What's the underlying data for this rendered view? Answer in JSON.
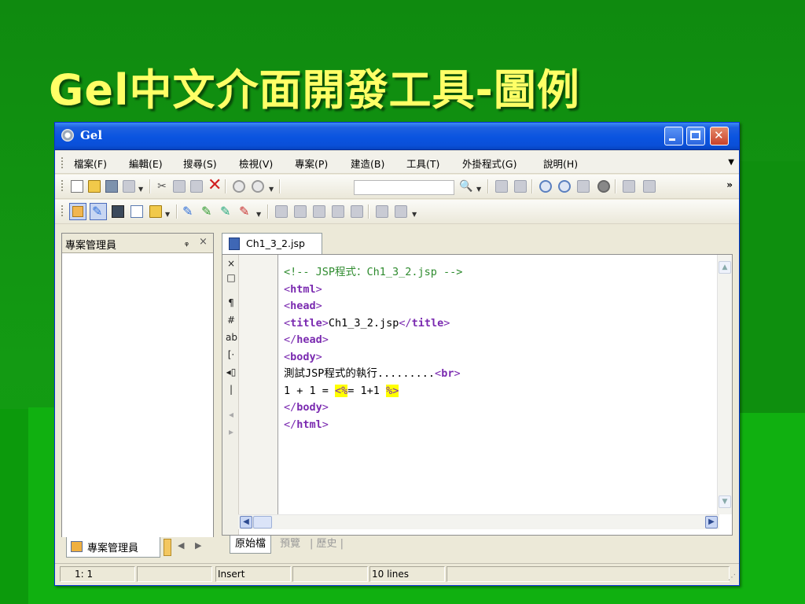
{
  "slide": {
    "title": "Gel中文介面開發工具-圖例"
  },
  "window": {
    "title": "Gel"
  },
  "menu": {
    "items": [
      "檔案(F)",
      "編輯(E)",
      "搜尋(S)",
      "檢視(V)",
      "專案(P)",
      "建造(B)",
      "工具(T)",
      "外掛程式(G)",
      "說明(H)"
    ]
  },
  "toolbar": {
    "combo_value": "",
    "overflow": "»"
  },
  "project_panel": {
    "title": "專案管理員",
    "pin": "ᵩ",
    "close": "×",
    "tab_label": "專案管理員"
  },
  "editor": {
    "tab_label": "Ch1_3_2.jsp",
    "lines": [
      [
        {
          "cls": "cm",
          "t": "<!-- JSP程式：Ch1_3_2.jsp -->"
        }
      ],
      [
        {
          "cls": "br",
          "t": "<"
        },
        {
          "cls": "tg",
          "t": "html"
        },
        {
          "cls": "br",
          "t": ">"
        }
      ],
      [
        {
          "cls": "br",
          "t": "<"
        },
        {
          "cls": "tg",
          "t": "head"
        },
        {
          "cls": "br",
          "t": ">"
        }
      ],
      [
        {
          "cls": "br",
          "t": "<"
        },
        {
          "cls": "tg",
          "t": "title"
        },
        {
          "cls": "br",
          "t": ">"
        },
        {
          "cls": "tx",
          "t": "Ch1_3_2.jsp"
        },
        {
          "cls": "br",
          "t": "</"
        },
        {
          "cls": "tg",
          "t": "title"
        },
        {
          "cls": "br",
          "t": ">"
        }
      ],
      [
        {
          "cls": "br",
          "t": "</"
        },
        {
          "cls": "tg",
          "t": "head"
        },
        {
          "cls": "br",
          "t": ">"
        }
      ],
      [
        {
          "cls": "br",
          "t": "<"
        },
        {
          "cls": "tg",
          "t": "body"
        },
        {
          "cls": "br",
          "t": ">"
        }
      ],
      [
        {
          "cls": "tx",
          "t": "測試JSP程式的執行........."
        },
        {
          "cls": "br",
          "t": "<"
        },
        {
          "cls": "tg",
          "t": "br"
        },
        {
          "cls": "br",
          "t": ">"
        }
      ],
      [
        {
          "cls": "tx",
          "t": "1 + 1 = "
        },
        {
          "cls": "hl",
          "t": "<%"
        },
        {
          "cls": "tx",
          "t": "= 1+1 "
        },
        {
          "cls": "hl",
          "t": "%>"
        }
      ],
      [
        {
          "cls": "br",
          "t": "</"
        },
        {
          "cls": "tg",
          "t": "body"
        },
        {
          "cls": "br",
          "t": ">"
        }
      ],
      [
        {
          "cls": "br",
          "t": "</"
        },
        {
          "cls": "tg",
          "t": "html"
        },
        {
          "cls": "br",
          "t": ">"
        }
      ]
    ],
    "view_tabs": [
      "原始檔",
      "預覽",
      "歷史"
    ]
  },
  "status": {
    "position": "1: 1",
    "mode": "Insert",
    "lines": "10 lines"
  },
  "colors": {
    "comment": "#2e8b2e",
    "tag": "#7a2ab0",
    "highlight": "#ffff00",
    "title_yellow": "#ffff66",
    "slide_green": "#118a11"
  }
}
